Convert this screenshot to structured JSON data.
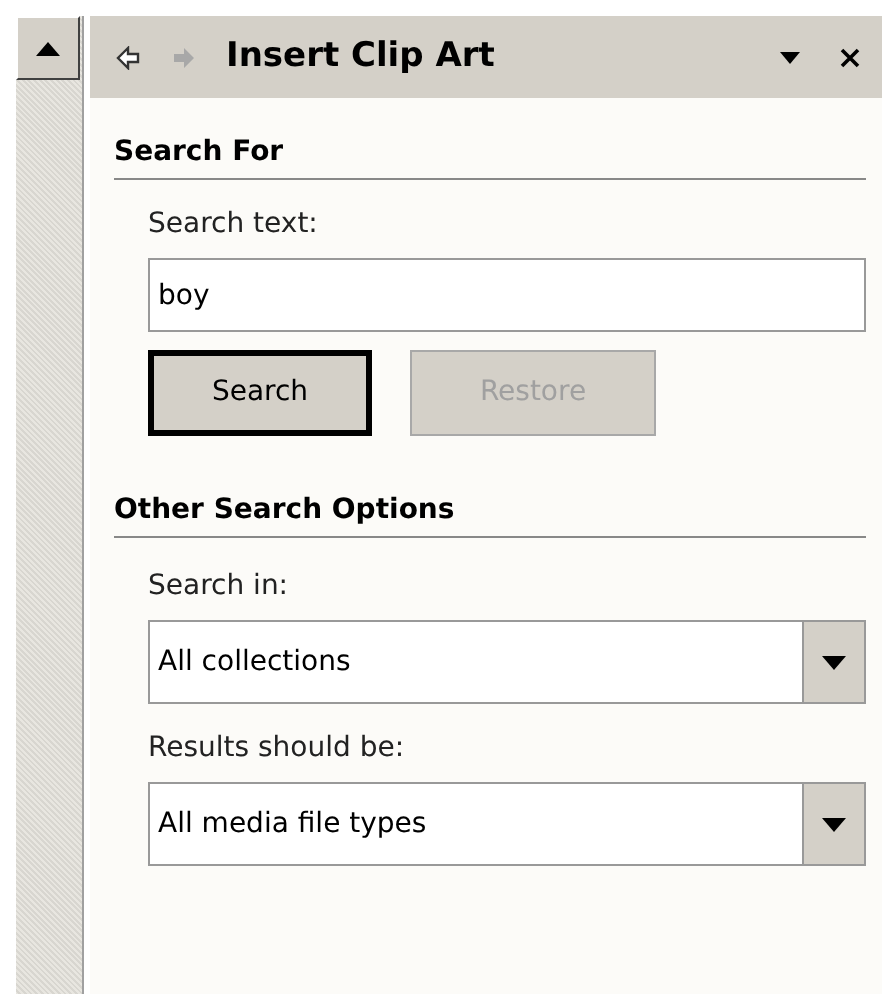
{
  "task_pane": {
    "title": "Insert Clip Art"
  },
  "search_for": {
    "heading": "Search For",
    "label": "Search text:",
    "value": "boy",
    "buttons": [
      {
        "label": "Search",
        "focused": true,
        "disabled": false
      },
      {
        "label": "Restore",
        "focused": false,
        "disabled": true
      }
    ]
  },
  "other_options": {
    "heading": "Other Search Options",
    "dropdowns": [
      {
        "label": "Search in:",
        "value": "All collections"
      },
      {
        "label": "Results should be:",
        "value": "All media file types"
      }
    ]
  }
}
